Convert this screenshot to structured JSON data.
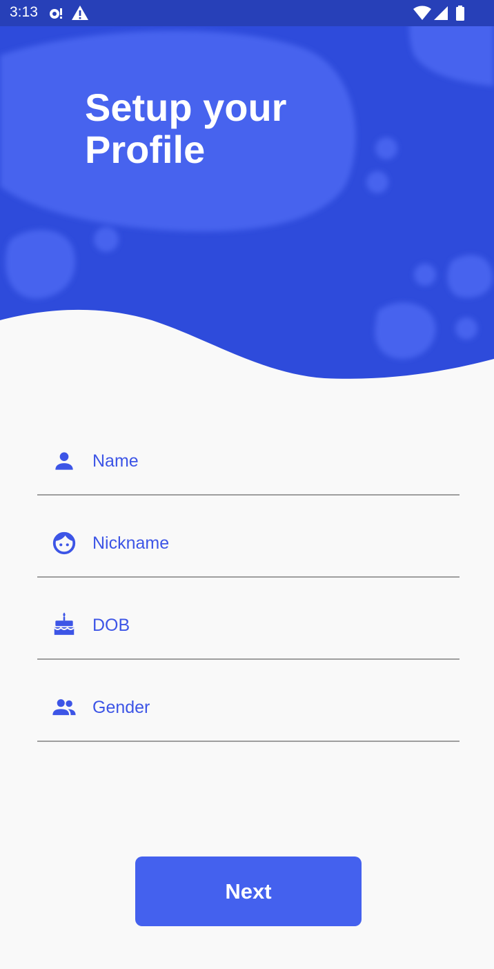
{
  "status_bar": {
    "time": "3:13",
    "left_icons": [
      "notification-icon",
      "warning-icon"
    ],
    "right_icons": [
      "wifi-icon",
      "signal-icon",
      "battery-icon"
    ]
  },
  "header": {
    "title": "Setup your Profile"
  },
  "form": {
    "fields": [
      {
        "name": "name",
        "placeholder": "Name",
        "icon": "person-icon"
      },
      {
        "name": "nickname",
        "placeholder": "Nickname",
        "icon": "face-icon"
      },
      {
        "name": "dob",
        "placeholder": "DOB",
        "icon": "cake-icon"
      },
      {
        "name": "gender",
        "placeholder": "Gender",
        "icon": "people-icon"
      }
    ]
  },
  "actions": {
    "next_label": "Next"
  },
  "colors": {
    "primary": "#4461EE",
    "header_blue": "#2E4BDB",
    "status_bar": "#2740B8",
    "background": "#F9F9F9",
    "field_text": "#3D55E6",
    "divider": "#9E9E9E"
  }
}
